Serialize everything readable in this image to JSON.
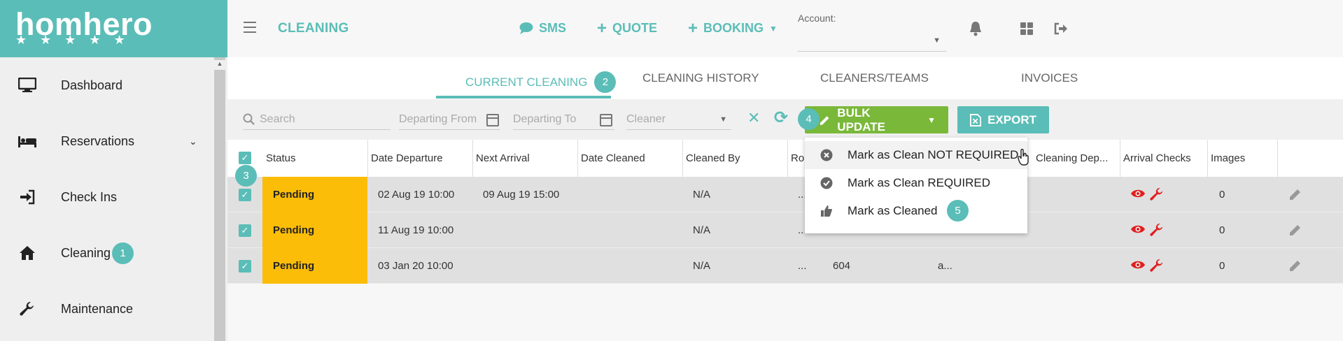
{
  "brand": {
    "name": "homhero",
    "stars": "★★★★★"
  },
  "sidebar": {
    "items": [
      {
        "label": "Dashboard"
      },
      {
        "label": "Reservations"
      },
      {
        "label": "Check Ins"
      },
      {
        "label": "Cleaning",
        "badge": "1"
      },
      {
        "label": "Maintenance"
      }
    ]
  },
  "topbar": {
    "title": "CLEANING",
    "sms": "SMS",
    "quote": "QUOTE",
    "booking": "BOOKING",
    "account_label": "Account:",
    "account_value": ""
  },
  "tabs": [
    {
      "label": "CURRENT CLEANING",
      "badge": "2",
      "active": true
    },
    {
      "label": "CLEANING HISTORY"
    },
    {
      "label": "CLEANERS/TEAMS"
    },
    {
      "label": "INVOICES"
    }
  ],
  "filters": {
    "search_placeholder": "Search",
    "departing_from_placeholder": "Departing From",
    "departing_to_placeholder": "Departing To",
    "cleaner_placeholder": "Cleaner",
    "bulk_update": "BULK UPDATE",
    "bulk_badge": "4",
    "export": "EXPORT"
  },
  "table": {
    "header_badge": "3",
    "columns": [
      "Status",
      "Date Departure",
      "Next Arrival",
      "Date Cleaned",
      "Cleaned By",
      "Ro",
      "Cleaning Dep...",
      "Arrival Checks",
      "Images"
    ],
    "rows": [
      {
        "status": "Pending",
        "date_departure": "02 Aug 19 10:00",
        "next_arrival": "09 Aug 19 15:00",
        "date_cleaned": "",
        "cleaned_by": "N/A",
        "ro": "...",
        "c6": "",
        "c7": "",
        "images": "0"
      },
      {
        "status": "Pending",
        "date_departure": "11 Aug 19 10:00",
        "next_arrival": "",
        "date_cleaned": "",
        "cleaned_by": "N/A",
        "ro": "...",
        "c6": "",
        "c7": "",
        "images": "0"
      },
      {
        "status": "Pending",
        "date_departure": "03 Jan 20 10:00",
        "next_arrival": "",
        "date_cleaned": "",
        "cleaned_by": "N/A",
        "ro": "...",
        "c6": "604",
        "c7": "a...",
        "images": "0"
      }
    ]
  },
  "dropdown": {
    "items": [
      {
        "label": "Mark as Clean NOT REQUIRED",
        "icon": "x-circle-icon"
      },
      {
        "label": "Mark as Clean REQUIRED",
        "icon": "check-circle-icon"
      },
      {
        "label": "Mark as Cleaned",
        "icon": "thumbs-up-icon",
        "badge": "5"
      }
    ]
  },
  "colors": {
    "accent": "#5bbdb7",
    "pending": "#fbbd08",
    "bulk": "#7ab83a",
    "alert": "#e02020"
  }
}
